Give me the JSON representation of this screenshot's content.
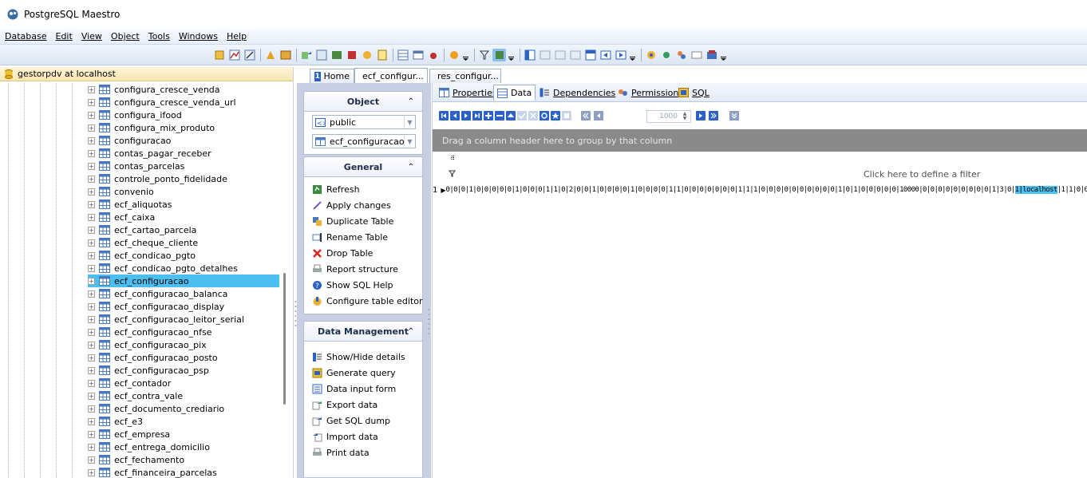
{
  "app": {
    "title": "PostgreSQL Maestro"
  },
  "menu": [
    "Database",
    "Edit",
    "View",
    "Object",
    "Tools",
    "Windows",
    "Help"
  ],
  "connection": {
    "label": "gestorpdv at localhost"
  },
  "tree": {
    "items": [
      "configura_cresce_venda",
      "configura_cresce_venda_url",
      "configura_ifood",
      "configura_mix_produto",
      "configuracao",
      "contas_pagar_receber",
      "contas_parcelas",
      "controle_ponto_fidelidade",
      "convenio",
      "ecf_aliquotas",
      "ecf_caixa",
      "ecf_cartao_parcela",
      "ecf_cheque_cliente",
      "ecf_condicao_pgto",
      "ecf_condicao_pgto_detalhes",
      "ecf_configuracao",
      "ecf_configuracao_balanca",
      "ecf_configuracao_display",
      "ecf_configuracao_leitor_serial",
      "ecf_configuracao_nfse",
      "ecf_configuracao_pix",
      "ecf_configuracao_posto",
      "ecf_configuracao_psp",
      "ecf_contador",
      "ecf_contra_vale",
      "ecf_documento_crediario",
      "ecf_e3",
      "ecf_empresa",
      "ecf_entrega_domicilio",
      "ecf_fechamento",
      "ecf_financeira_parcelas"
    ],
    "selected_index": 15
  },
  "tabs": [
    {
      "label": "Home",
      "num": "1"
    },
    {
      "label": "ecf_configur..."
    },
    {
      "label": "res_configur..."
    }
  ],
  "nav": {
    "object_header": "Object",
    "schema_value": "public",
    "table_value": "ecf_configuracao",
    "general_header": "General",
    "general_links": [
      "Refresh",
      "Apply changes",
      "Duplicate Table",
      "Rename Table",
      "Drop Table",
      "Report structure",
      "Show SQL Help",
      "Configure table editor"
    ],
    "data_header": "Data Management",
    "data_links": [
      "Show/Hide details",
      "Generate query",
      "Data input form",
      "Export data",
      "Get SQL dump",
      "Import data",
      "Print data"
    ]
  },
  "subtabs": [
    "Properties",
    "Data",
    "Dependencies",
    "Permissions",
    "SQL"
  ],
  "grid": {
    "page_size": "1000",
    "group_hint": "Drag a column header here to group by that column",
    "filter_hint": "Click here to define a filter",
    "row_number": "1",
    "row_values": "0|0|0|1|0|0|0|0|0|1|0|0|0|1|1|0|2|0|0|1|0|0|0|0|1|0|0|0|0|1|1|0|0|0|0|0|0|0|1|1|1|0|0|0|0|0|0|0|0|0|0|1|0|1|0|0|0|0|0|10000|0|0|0|0|0|0|0|0|0|1|3|0|",
    "row_highlight": "1|localhost",
    "row_tail": "|1|1|0|0"
  },
  "colors": {
    "selection": "#4bc0f0",
    "accent": "#2b62c8"
  }
}
